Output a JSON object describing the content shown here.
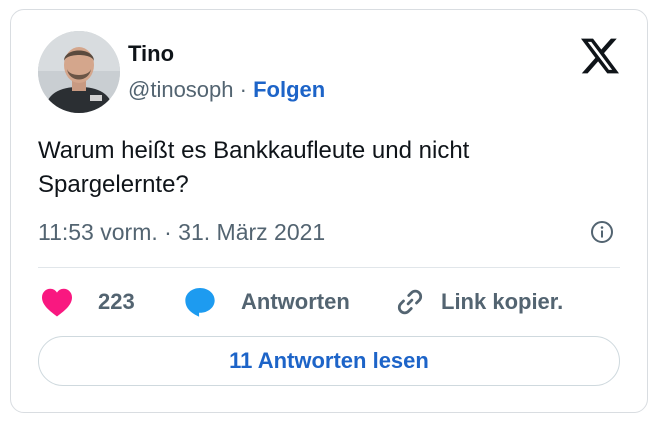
{
  "author": {
    "display_name": "Tino",
    "handle": "@tinosoph",
    "separator": "·",
    "follow_label": "Folgen",
    "avatar_icon": "profile-photo"
  },
  "platform": {
    "logo_icon": "x-logo"
  },
  "tweet": {
    "text": "Warum heißt es Bankkaufleute und nicht\nSpargelernte?",
    "timestamp": "11:53 vorm. · 31. März 2021"
  },
  "actions": {
    "like_count": "223",
    "like_icon": "heart-icon",
    "like_color": "#f91880",
    "reply_label": "Antworten",
    "reply_icon": "speech-bubble-icon",
    "reply_color": "#1d9bf0",
    "copy_label": "Link kopier.",
    "copy_icon": "link-icon"
  },
  "footer": {
    "read_replies_label": "11 Antworten lesen"
  },
  "colors": {
    "link": "#1d64c8",
    "text": "#0f1419",
    "secondary": "#536471",
    "border": "#d9dde1"
  }
}
